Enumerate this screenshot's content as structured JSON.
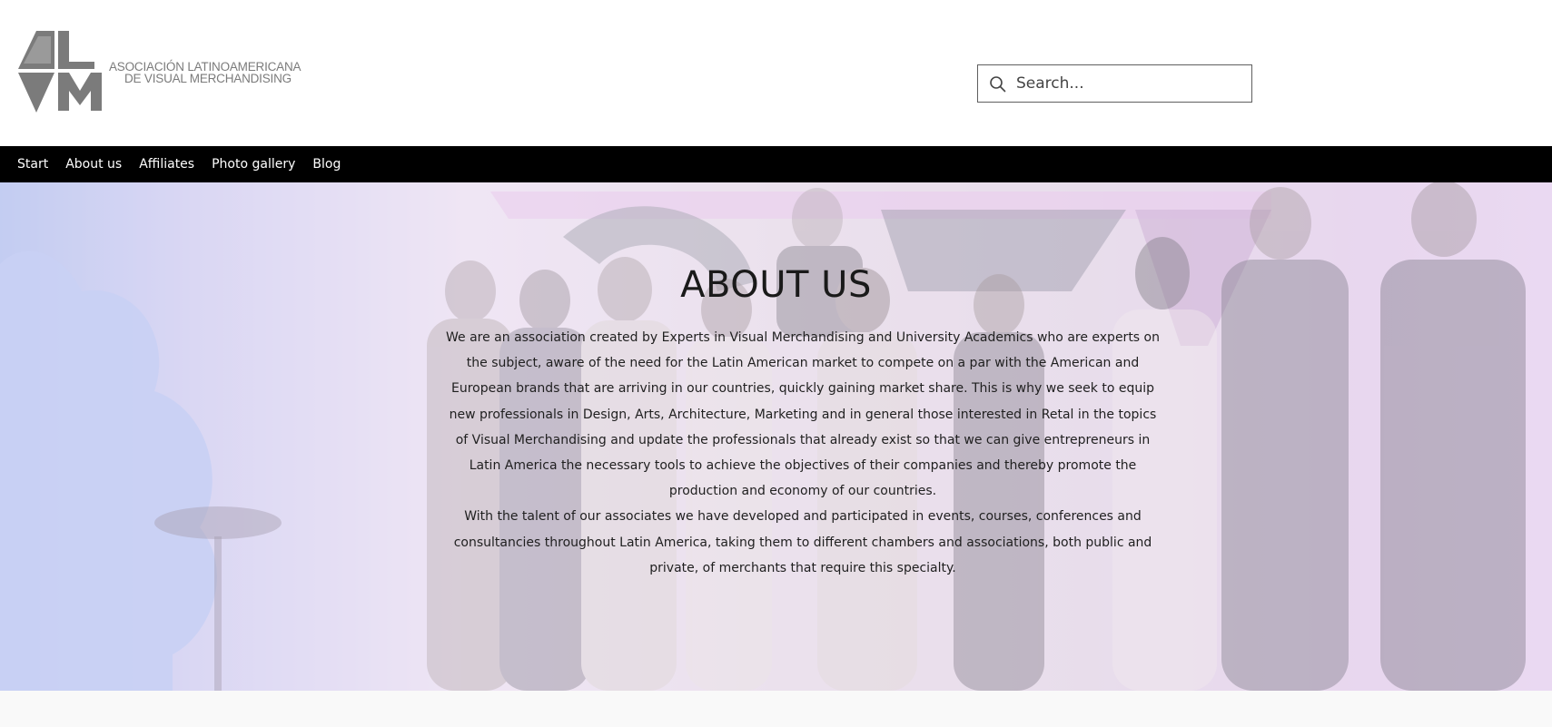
{
  "header": {
    "logo": {
      "line1": "ASOCIACIÓN LATINOAMERICANA",
      "line2": "DE VISUAL MERCHANDISING",
      "color": "#7b7b7b"
    },
    "search": {
      "placeholder": "Search...",
      "value": "",
      "icon": "search-icon"
    }
  },
  "nav": {
    "items": [
      {
        "label": "Start"
      },
      {
        "label": "About us"
      },
      {
        "label": "Affiliates"
      },
      {
        "label": "Photo gallery"
      },
      {
        "label": "Blog"
      }
    ]
  },
  "hero": {
    "title": "ABOUT US",
    "paragraph1": "We are an association created by Experts in Visual Merchandising and University Academics who are experts on the subject, aware of the need for the Latin American market to compete on a par with the American and European brands that are arriving in our countries, quickly gaining market share. This is why we seek to equip new professionals in Design, Arts, Architecture, Marketing and in general those interested in Retal in the topics of Visual Merchandising and update the professionals that already exist so that we can give entrepreneurs in Latin America the necessary tools to achieve the objectives of their companies and thereby promote the production and economy of our countries.",
    "paragraph2": "With the talent of our associates we have developed and participated in events, courses, conferences and consultancies throughout Latin America, taking them to different chambers and associations, both public and private, of merchants that require this specialty."
  },
  "colors": {
    "nav_bg": "#000000",
    "nav_text": "#ffffff",
    "body_text": "#1f1f1f"
  }
}
